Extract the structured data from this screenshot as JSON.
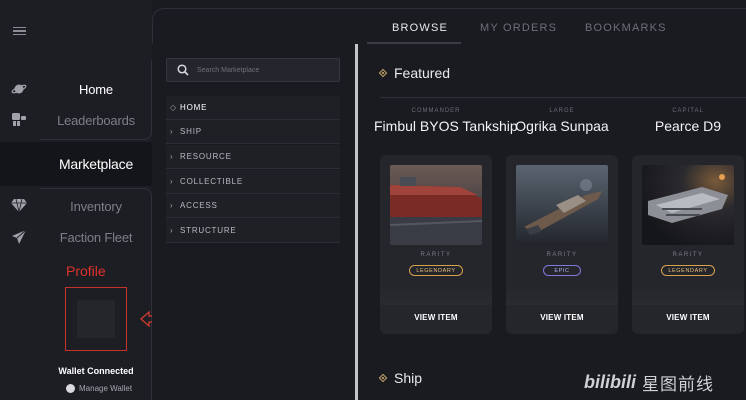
{
  "rail": {
    "icons": [
      "menu-icon",
      "planet-icon",
      "robot-icon",
      "cart-icon",
      "gem-icon",
      "jet-icon"
    ]
  },
  "nav": {
    "home": "Home",
    "leaderboards": "Leaderboards",
    "marketplace": "Marketplace",
    "inventory": "Inventory",
    "faction_fleet": "Faction Fleet"
  },
  "profile": {
    "label": "Profile",
    "wallet_status": "Wallet Connected",
    "manage_wallet": "Manage Wallet"
  },
  "tabs": [
    {
      "label": "BROWSE",
      "active": true
    },
    {
      "label": "MY ORDERS",
      "active": false
    },
    {
      "label": "BOOKMARKS",
      "active": false
    }
  ],
  "search": {
    "placeholder": "Search Marketplace"
  },
  "categories": [
    {
      "label": "HOME",
      "selected": true
    },
    {
      "label": "SHIP",
      "selected": false
    },
    {
      "label": "RESOURCE",
      "selected": false
    },
    {
      "label": "COLLECTIBLE",
      "selected": false
    },
    {
      "label": "ACCESS",
      "selected": false
    },
    {
      "label": "STRUCTURE",
      "selected": false
    }
  ],
  "featured": {
    "heading": "Featured",
    "items": [
      {
        "type": "COMMANDER",
        "name": "Fimbul BYOS Tankship",
        "rarity_label": "RARITY",
        "rarity": "LEGENDARY",
        "view": "VIEW ITEM"
      },
      {
        "type": "LARGE",
        "name": "Ogrika Sunpaa",
        "rarity_label": "RARITY",
        "rarity": "EPIC",
        "view": "VIEW ITEM"
      },
      {
        "type": "CAPITAL",
        "name": "Pearce D9",
        "rarity_label": "RARITY",
        "rarity": "LEGENDARY",
        "view": "VIEW ITEM"
      }
    ]
  },
  "ship_section": {
    "heading": "Ship"
  },
  "watermark": {
    "brand": "bilibili",
    "text": "星图前线"
  },
  "colors": {
    "accent_gold": "#c8a86a",
    "legendary": "#d6a24a",
    "epic": "#7c79d9",
    "profile_red": "#e0312b"
  }
}
